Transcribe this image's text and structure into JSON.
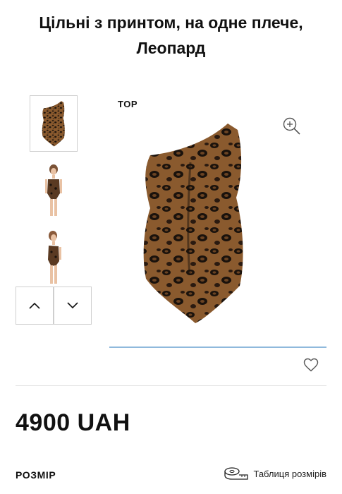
{
  "product": {
    "title": "Цільні з принтом, на одне плече, Леопард",
    "badge": "TOP",
    "price": "4900 UAH"
  },
  "gallery": {
    "thumbnails": [
      "swimsuit-front",
      "model-front",
      "model-side"
    ],
    "selected_index": 0,
    "progress_fraction": 1.0
  },
  "icons": {
    "zoom": "zoom-in-icon",
    "prev": "chevron-up-icon",
    "next": "chevron-down-icon",
    "favorite": "heart-icon",
    "size_chart": "measuring-tape-icon"
  },
  "sizes": {
    "label": "РОЗМІР",
    "chart_link": "Таблиця розмірів"
  },
  "colors": {
    "accent": "#8fb9dc",
    "text": "#111111",
    "leopard_base": "#8a5a2e",
    "leopard_spot": "#1a120c"
  }
}
